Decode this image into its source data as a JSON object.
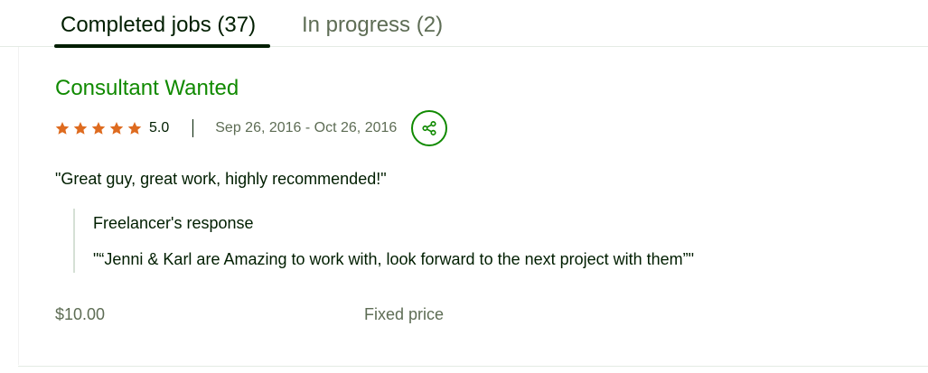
{
  "tabs": [
    {
      "label": "Completed jobs (37)",
      "active": true
    },
    {
      "label": "In progress (2)",
      "active": false
    }
  ],
  "job": {
    "title": "Consultant Wanted",
    "rating": "5.0",
    "stars": 5,
    "dates": "Sep 26, 2016 - Oct 26, 2016",
    "share_icon": "share-icon",
    "feedback": "\"Great guy, great work, highly recommended!\"",
    "response": {
      "heading": "Freelancer's response",
      "text": "\"“Jenni & Karl are Amazing to work with, look forward to the next project with them”\""
    },
    "price": "$10.00",
    "price_type": "Fixed price"
  },
  "colors": {
    "title_green": "#108a00",
    "star_orange": "#de6b1f",
    "text_dark": "#001e00",
    "text_muted": "#5e6d55"
  }
}
